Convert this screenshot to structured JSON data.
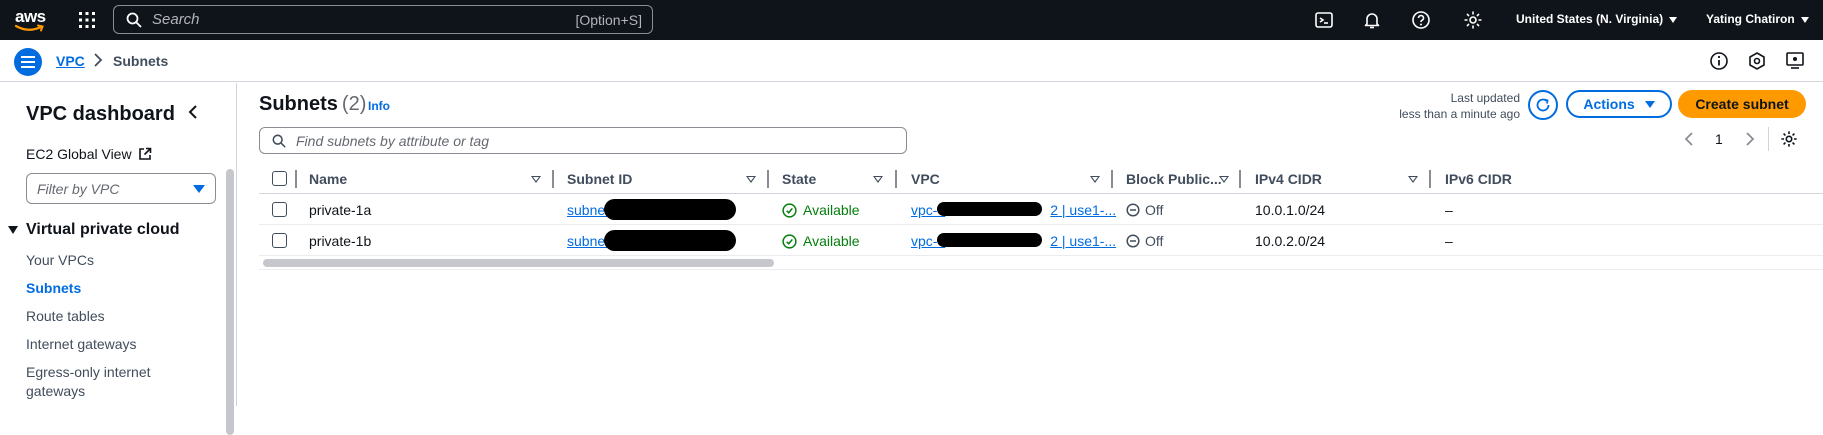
{
  "topnav": {
    "logo_text": "aws",
    "search_placeholder": "Search",
    "search_shortcut": "[Option+S]",
    "region": "United States (N. Virginia)",
    "user": "Yating Chatiron"
  },
  "breadcrumb": {
    "root": "VPC",
    "current": "Subnets"
  },
  "sidebar": {
    "title": "VPC dashboard",
    "ec2_global_view": "EC2 Global View",
    "filter_placeholder": "Filter by VPC",
    "section": "Virtual private cloud",
    "items": [
      {
        "label": "Your VPCs",
        "active": false
      },
      {
        "label": "Subnets",
        "active": true
      },
      {
        "label": "Route tables",
        "active": false
      },
      {
        "label": "Internet gateways",
        "active": false
      },
      {
        "label": "Egress-only internet gateways",
        "active": false
      }
    ]
  },
  "header": {
    "title": "Subnets",
    "count": "(2)",
    "info": "Info",
    "last_updated_line1": "Last updated",
    "last_updated_line2": "less than a minute ago",
    "actions_label": "Actions",
    "create_label": "Create subnet"
  },
  "table": {
    "search_placeholder": "Find subnets by attribute or tag",
    "page": "1",
    "columns": [
      "Name",
      "Subnet ID",
      "State",
      "VPC",
      "Block Public...",
      "IPv4 CIDR",
      "IPv6 CIDR"
    ],
    "rows": [
      {
        "name": "private-1a",
        "subnet_id": "subnet-",
        "state": "Available",
        "vpc_prefix": "vpc-0",
        "vpc_suffix": "2 | use1-...",
        "block_public": "Off",
        "ipv4": "10.0.1.0/24",
        "ipv6": "–"
      },
      {
        "name": "private-1b",
        "subnet_id": "subnet-",
        "state": "Available",
        "vpc_prefix": "vpc-0",
        "vpc_suffix": "2 | use1-...",
        "block_public": "Off",
        "ipv4": "10.0.2.0/24",
        "ipv6": "–"
      }
    ]
  },
  "colors": {
    "nav_bg": "#0f141a",
    "link_blue": "#006ce0",
    "primary_orange": "#ff9900",
    "success_green": "#037f0c"
  },
  "icons": [
    "aws-smile-icon",
    "apps-grid-icon",
    "search-icon",
    "cloudshell-icon",
    "bell-icon",
    "help-icon",
    "gear-icon",
    "menu-icon",
    "chevron-right-icon",
    "info-icon",
    "feedback-icon",
    "preferences-icon",
    "chevron-left-icon",
    "external-link-icon",
    "caret-down-icon",
    "refresh-icon",
    "check-circle-icon",
    "off-circle-icon"
  ]
}
